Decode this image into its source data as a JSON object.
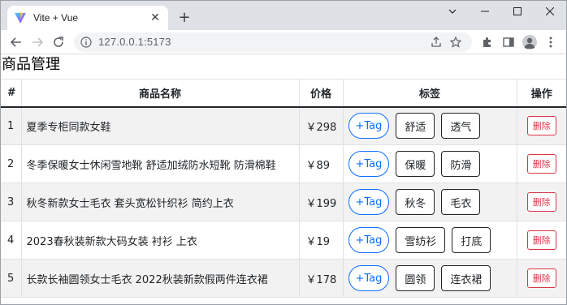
{
  "browser": {
    "tab_title": "Vite + Vue",
    "url": "127.0.0.1:5173"
  },
  "page": {
    "title": "商品管理"
  },
  "table": {
    "headers": {
      "index": "#",
      "name": "商品名称",
      "price": "价格",
      "tags": "标签",
      "ops": "操作"
    },
    "add_tag_label": "+Tag",
    "delete_label": "删除",
    "rows": [
      {
        "index": "1",
        "name": "夏季专柜同款女鞋",
        "price": "￥298",
        "tags": [
          "舒适",
          "透气"
        ]
      },
      {
        "index": "2",
        "name": "冬季保暖女士休闲雪地靴 舒适加绒防水短靴 防滑棉鞋",
        "price": "￥89",
        "tags": [
          "保暖",
          "防滑"
        ]
      },
      {
        "index": "3",
        "name": "秋冬新款女士毛衣 套头宽松针织衫 简约上衣",
        "price": "￥199",
        "tags": [
          "秋冬",
          "毛衣"
        ]
      },
      {
        "index": "4",
        "name": "2023春秋装新款大码女装 衬衫 上衣",
        "price": "￥19",
        "tags": [
          "雪纺衫",
          "打底"
        ]
      },
      {
        "index": "5",
        "name": "长款长袖圆领女士毛衣 2022秋装新款假两件连衣裙",
        "price": "￥178",
        "tags": [
          "圆领",
          "连衣裙"
        ]
      }
    ]
  },
  "colors": {
    "primary": "#0d6efd",
    "danger": "#dc3545",
    "stripe": "#f2f2f2",
    "tabstrip": "#dee1e6"
  },
  "icons": {
    "favicon": "vite-logo-icon",
    "back": "arrow-left-icon",
    "forward": "arrow-right-icon",
    "reload": "reload-icon",
    "info": "info-icon",
    "share": "share-icon",
    "bookmark": "star-icon",
    "extensions": "puzzle-icon",
    "sidepanel": "side-panel-icon",
    "profile": "profile-icon",
    "menu": "kebab-menu-icon"
  }
}
